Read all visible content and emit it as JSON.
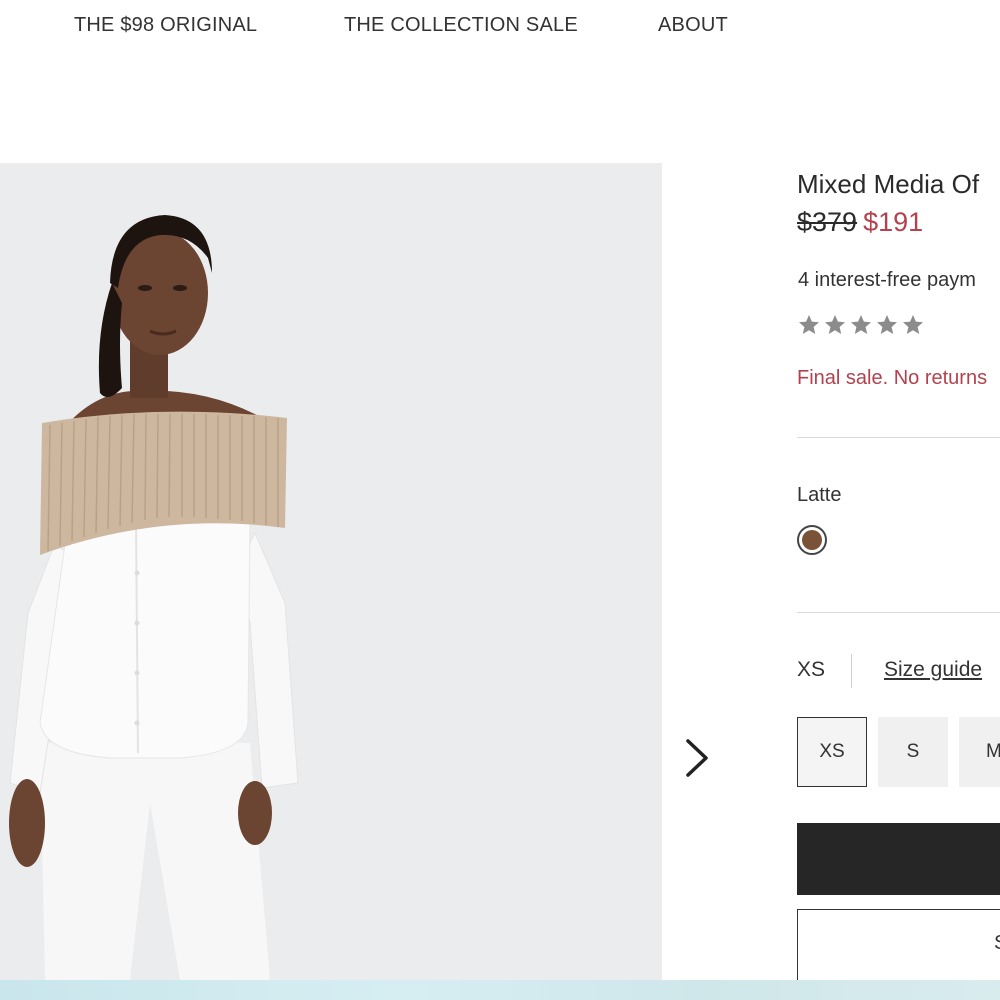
{
  "nav": {
    "items": [
      "THE $98 ORIGINAL",
      "THE COLLECTION SALE",
      "ABOUT"
    ]
  },
  "product": {
    "title": "Mixed Media Of",
    "price_original": "$379",
    "price_sale": "$191",
    "payments_text": "4 interest-free paym",
    "rating_stars": 5,
    "final_sale_text": "Final sale. No returns",
    "color_label": "Latte",
    "swatch_color": "#7a5238",
    "size_selected": "XS",
    "size_guide_label": "Size guide",
    "sizes": [
      "XS",
      "S",
      "M"
    ],
    "secondary_button_initial": "S"
  },
  "colors": {
    "sale_red": "#b3424e",
    "primary_button": "#262626",
    "image_background": "#ebecee",
    "star_gray": "#8c8c8c"
  },
  "icons": {
    "next": "chevron-right-icon",
    "star": "star-icon"
  }
}
